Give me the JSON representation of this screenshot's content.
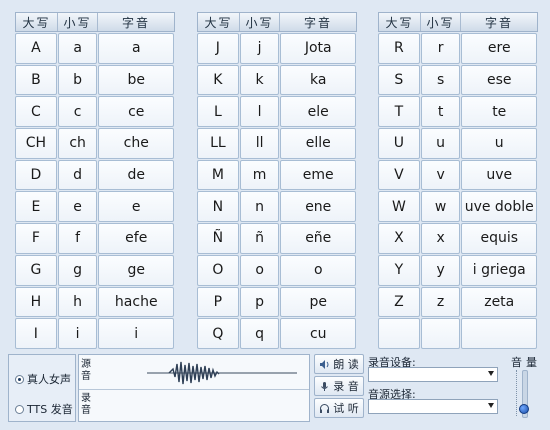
{
  "headers": {
    "upper": "大写",
    "lower": "小写",
    "name": "字音"
  },
  "columns": [
    {
      "rows": [
        {
          "upper": "A",
          "lower": "a",
          "name": "a"
        },
        {
          "upper": "B",
          "lower": "b",
          "name": "be"
        },
        {
          "upper": "C",
          "lower": "c",
          "name": "ce"
        },
        {
          "upper": "CH",
          "lower": "ch",
          "name": "che"
        },
        {
          "upper": "D",
          "lower": "d",
          "name": "de"
        },
        {
          "upper": "E",
          "lower": "e",
          "name": "e"
        },
        {
          "upper": "F",
          "lower": "f",
          "name": "efe"
        },
        {
          "upper": "G",
          "lower": "g",
          "name": "ge"
        },
        {
          "upper": "H",
          "lower": "h",
          "name": "hache"
        },
        {
          "upper": "I",
          "lower": "i",
          "name": "i"
        }
      ]
    },
    {
      "rows": [
        {
          "upper": "J",
          "lower": "j",
          "name": "Jota"
        },
        {
          "upper": "K",
          "lower": "k",
          "name": "ka"
        },
        {
          "upper": "L",
          "lower": "l",
          "name": "ele"
        },
        {
          "upper": "LL",
          "lower": "ll",
          "name": "elle"
        },
        {
          "upper": "M",
          "lower": "m",
          "name": "eme"
        },
        {
          "upper": "N",
          "lower": "n",
          "name": "ene"
        },
        {
          "upper": "Ñ",
          "lower": "ñ",
          "name": "eñe"
        },
        {
          "upper": "O",
          "lower": "o",
          "name": "o"
        },
        {
          "upper": "P",
          "lower": "p",
          "name": "pe"
        },
        {
          "upper": "Q",
          "lower": "q",
          "name": "cu"
        }
      ]
    },
    {
      "rows": [
        {
          "upper": "R",
          "lower": "r",
          "name": "ere"
        },
        {
          "upper": "S",
          "lower": "s",
          "name": "ese"
        },
        {
          "upper": "T",
          "lower": "t",
          "name": "te"
        },
        {
          "upper": "U",
          "lower": "u",
          "name": "u"
        },
        {
          "upper": "V",
          "lower": "v",
          "name": "uve"
        },
        {
          "upper": "W",
          "lower": "w",
          "name": "uve doble"
        },
        {
          "upper": "X",
          "lower": "x",
          "name": "equis"
        },
        {
          "upper": "Y",
          "lower": "y",
          "name": "i griega"
        },
        {
          "upper": "Z",
          "lower": "z",
          "name": "zeta"
        },
        {
          "upper": "",
          "lower": "",
          "name": ""
        }
      ]
    }
  ],
  "voice_mode": {
    "options": [
      {
        "label": "真人女声",
        "selected": true
      },
      {
        "label": "TTS 发音",
        "selected": false
      }
    ]
  },
  "waveform": {
    "source_label": "源音",
    "record_label": "录音"
  },
  "buttons": {
    "read": "朗 读",
    "record": "录 音",
    "listen": "试 听"
  },
  "device": {
    "record_label": "录音设备:",
    "record_value": "",
    "source_label": "音源选择:",
    "source_value": ""
  },
  "volume": {
    "label": "音量",
    "level": 0.1
  },
  "colors": {
    "accent": "#1b4ea8",
    "panel": "#dfe8f3",
    "cell_border": "#a8bdd4"
  }
}
